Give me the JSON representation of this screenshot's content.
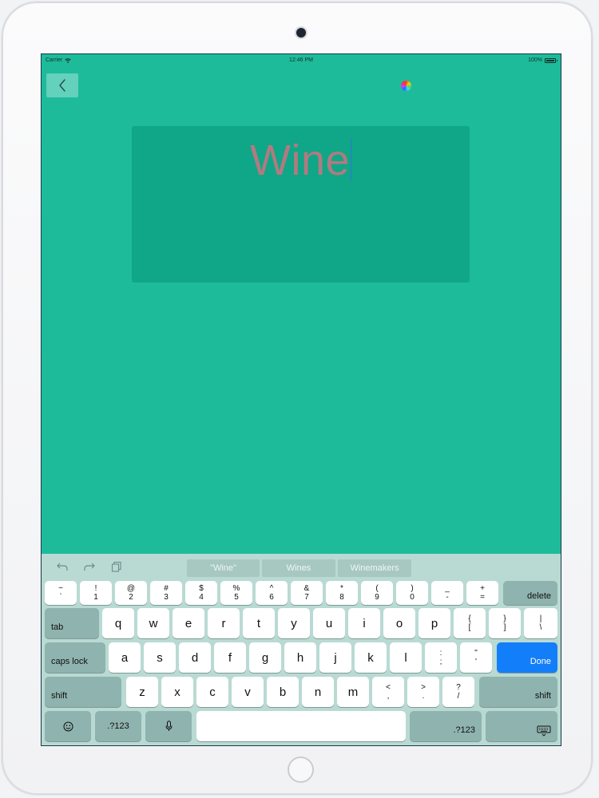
{
  "status_bar": {
    "carrier": "Carrier",
    "time": "12:46 PM",
    "battery": "100%"
  },
  "icons": {
    "back": "chevron-left-icon",
    "color": "color-wheel-icon",
    "wifi": "wifi-icon",
    "battery": "battery-icon",
    "undo": "undo-icon",
    "redo": "redo-icon",
    "paste": "paste-icon",
    "emoji": "emoji-icon",
    "mic": "microphone-icon",
    "hide_keyboard": "keyboard-hide-icon"
  },
  "colors": {
    "background": "#1ebb9b",
    "card": "#10a688",
    "text": "#b07b80",
    "done_key": "#137ef9"
  },
  "editor": {
    "text": "Wine"
  },
  "keyboard": {
    "suggestions": [
      "\"Wine\"",
      "Wines",
      "Winemakers"
    ],
    "number_row": [
      {
        "top": "~",
        "bottom": "`"
      },
      {
        "top": "!",
        "bottom": "1"
      },
      {
        "top": "@",
        "bottom": "2"
      },
      {
        "top": "#",
        "bottom": "3"
      },
      {
        "top": "$",
        "bottom": "4"
      },
      {
        "top": "%",
        "bottom": "5"
      },
      {
        "top": "^",
        "bottom": "6"
      },
      {
        "top": "&",
        "bottom": "7"
      },
      {
        "top": "*",
        "bottom": "8"
      },
      {
        "top": "(",
        "bottom": "9"
      },
      {
        "top": ")",
        "bottom": "0"
      },
      {
        "top": "_",
        "bottom": "-"
      },
      {
        "top": "+",
        "bottom": "="
      }
    ],
    "delete": "delete",
    "tab": "tab",
    "row_q": [
      "q",
      "w",
      "e",
      "r",
      "t",
      "y",
      "u",
      "i",
      "o",
      "p"
    ],
    "row_q_symbols": [
      {
        "top": "{",
        "bottom": "["
      },
      {
        "top": "}",
        "bottom": "]"
      },
      {
        "top": "|",
        "bottom": "\\"
      }
    ],
    "caps_lock": "caps lock",
    "row_a": [
      "a",
      "s",
      "d",
      "f",
      "g",
      "h",
      "j",
      "k",
      "l"
    ],
    "row_a_symbols": [
      {
        "top": ":",
        "bottom": ";"
      },
      {
        "top": "\"",
        "bottom": "'"
      }
    ],
    "done": "Done",
    "shift": "shift",
    "row_z": [
      "z",
      "x",
      "c",
      "v",
      "b",
      "n",
      "m"
    ],
    "row_z_symbols": [
      {
        "top": "<",
        "bottom": ","
      },
      {
        "top": ">",
        "bottom": "."
      },
      {
        "top": "?",
        "bottom": "/"
      }
    ],
    "numbers_key": ".?123"
  }
}
